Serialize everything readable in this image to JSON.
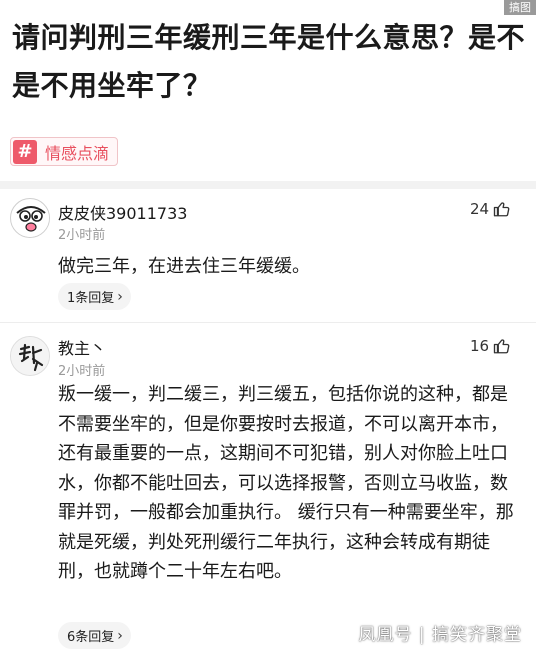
{
  "watermark_top": "搞图",
  "question": {
    "title": "请问判刑三年缓刑三年是什么意思？是不是不用坐牢了？"
  },
  "topic": {
    "icon": "hash-icon",
    "label": "情感点滴",
    "color": "#e8505f"
  },
  "comments": [
    {
      "username": "皮皮侠39011733",
      "time": "2小时前",
      "likes": "24",
      "content": "做完三年，在进去住三年缓缓。",
      "replies": "1条回复"
    },
    {
      "username": "教主丶",
      "time": "2小时前",
      "likes": "16",
      "content": "叛一缓一，判二缓三，判三缓五，包括你说的这种，都是不需要坐牢的，但是你要按时去报道，不可以离开本市，还有最重要的一点，这期间不可犯错，别人对你脸上吐口水，你都不能吐回去，可以选择报警，否则立马收监，数罪并罚，一般都会加重执行。      缓行只有一种需要坐牢，那就是死缓，判处死刑缓行二年执行，这种会转成有期徒刑，也就蹲个二十年左右吧。",
      "replies": "6条回复"
    }
  ],
  "brand": "凤凰号 | 搞笑齐聚堂"
}
